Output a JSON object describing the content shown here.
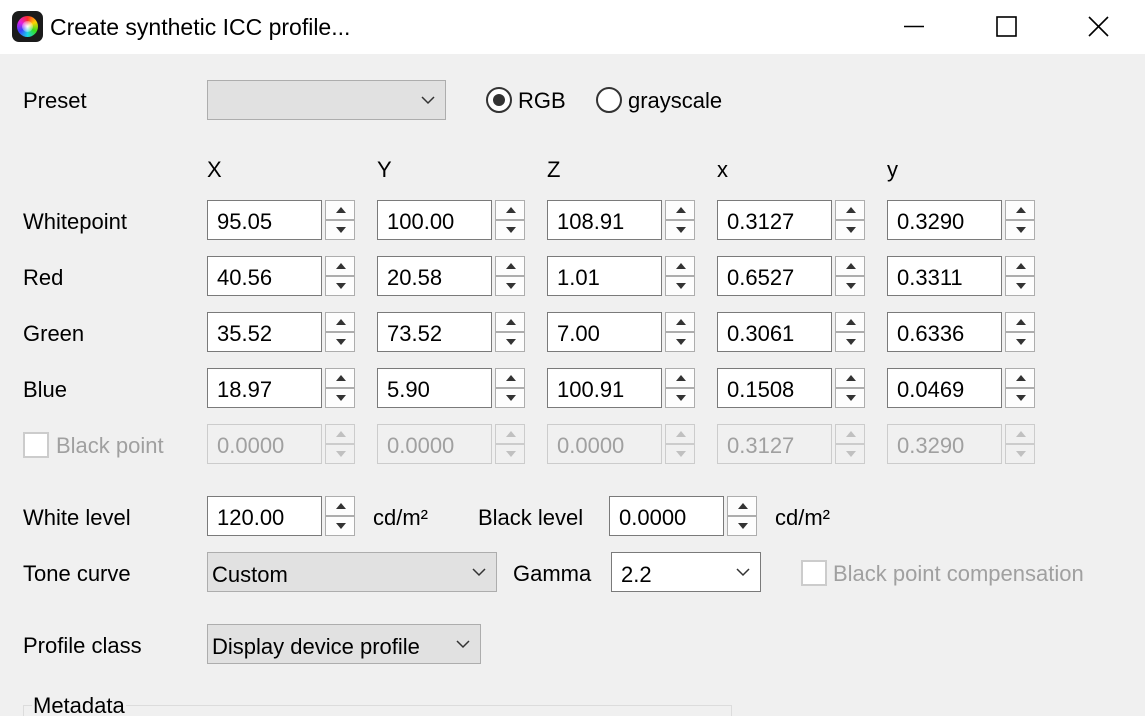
{
  "window": {
    "title": "Create synthetic ICC profile...",
    "app_icon": "color-wheel-icon",
    "controls": [
      "minimize-icon",
      "maximize-icon",
      "close-icon"
    ]
  },
  "preset": {
    "label": "Preset",
    "value": ""
  },
  "color_mode": {
    "options": [
      "RGB",
      "grayscale"
    ],
    "selected": "RGB"
  },
  "columns": [
    "X",
    "Y",
    "Z",
    "x",
    "y"
  ],
  "rows": [
    {
      "label": "Whitepoint",
      "values": [
        "95.05",
        "100.00",
        "108.91",
        "0.3127",
        "0.3290"
      ]
    },
    {
      "label": "Red",
      "values": [
        "40.56",
        "20.58",
        "1.01",
        "0.6527",
        "0.3311"
      ]
    },
    {
      "label": "Green",
      "values": [
        "35.52",
        "73.52",
        "7.00",
        "0.3061",
        "0.6336"
      ]
    },
    {
      "label": "Blue",
      "values": [
        "18.97",
        "5.90",
        "100.91",
        "0.1508",
        "0.0469"
      ]
    }
  ],
  "black_point": {
    "label": "Black point",
    "checked": false,
    "enabled": false,
    "values": [
      "0.0000",
      "0.0000",
      "0.0000",
      "0.3127",
      "0.3290"
    ]
  },
  "levels": {
    "white_label": "White level",
    "white_value": "120.00",
    "black_label": "Black level",
    "black_value": "0.0000",
    "unit": "cd/m²"
  },
  "tone_curve": {
    "label": "Tone curve",
    "value": "Custom",
    "gamma_label": "Gamma",
    "gamma_value": "2.2",
    "bpc_label": "Black point compensation",
    "bpc_checked": false,
    "bpc_enabled": false
  },
  "profile_class": {
    "label": "Profile class",
    "value": "Display device profile"
  },
  "metadata": {
    "label": "Metadata"
  },
  "colors": {
    "window_bg": "#f0f0f0",
    "titlebar_bg": "#ffffff",
    "disabled_text": "#a0a0a0"
  }
}
